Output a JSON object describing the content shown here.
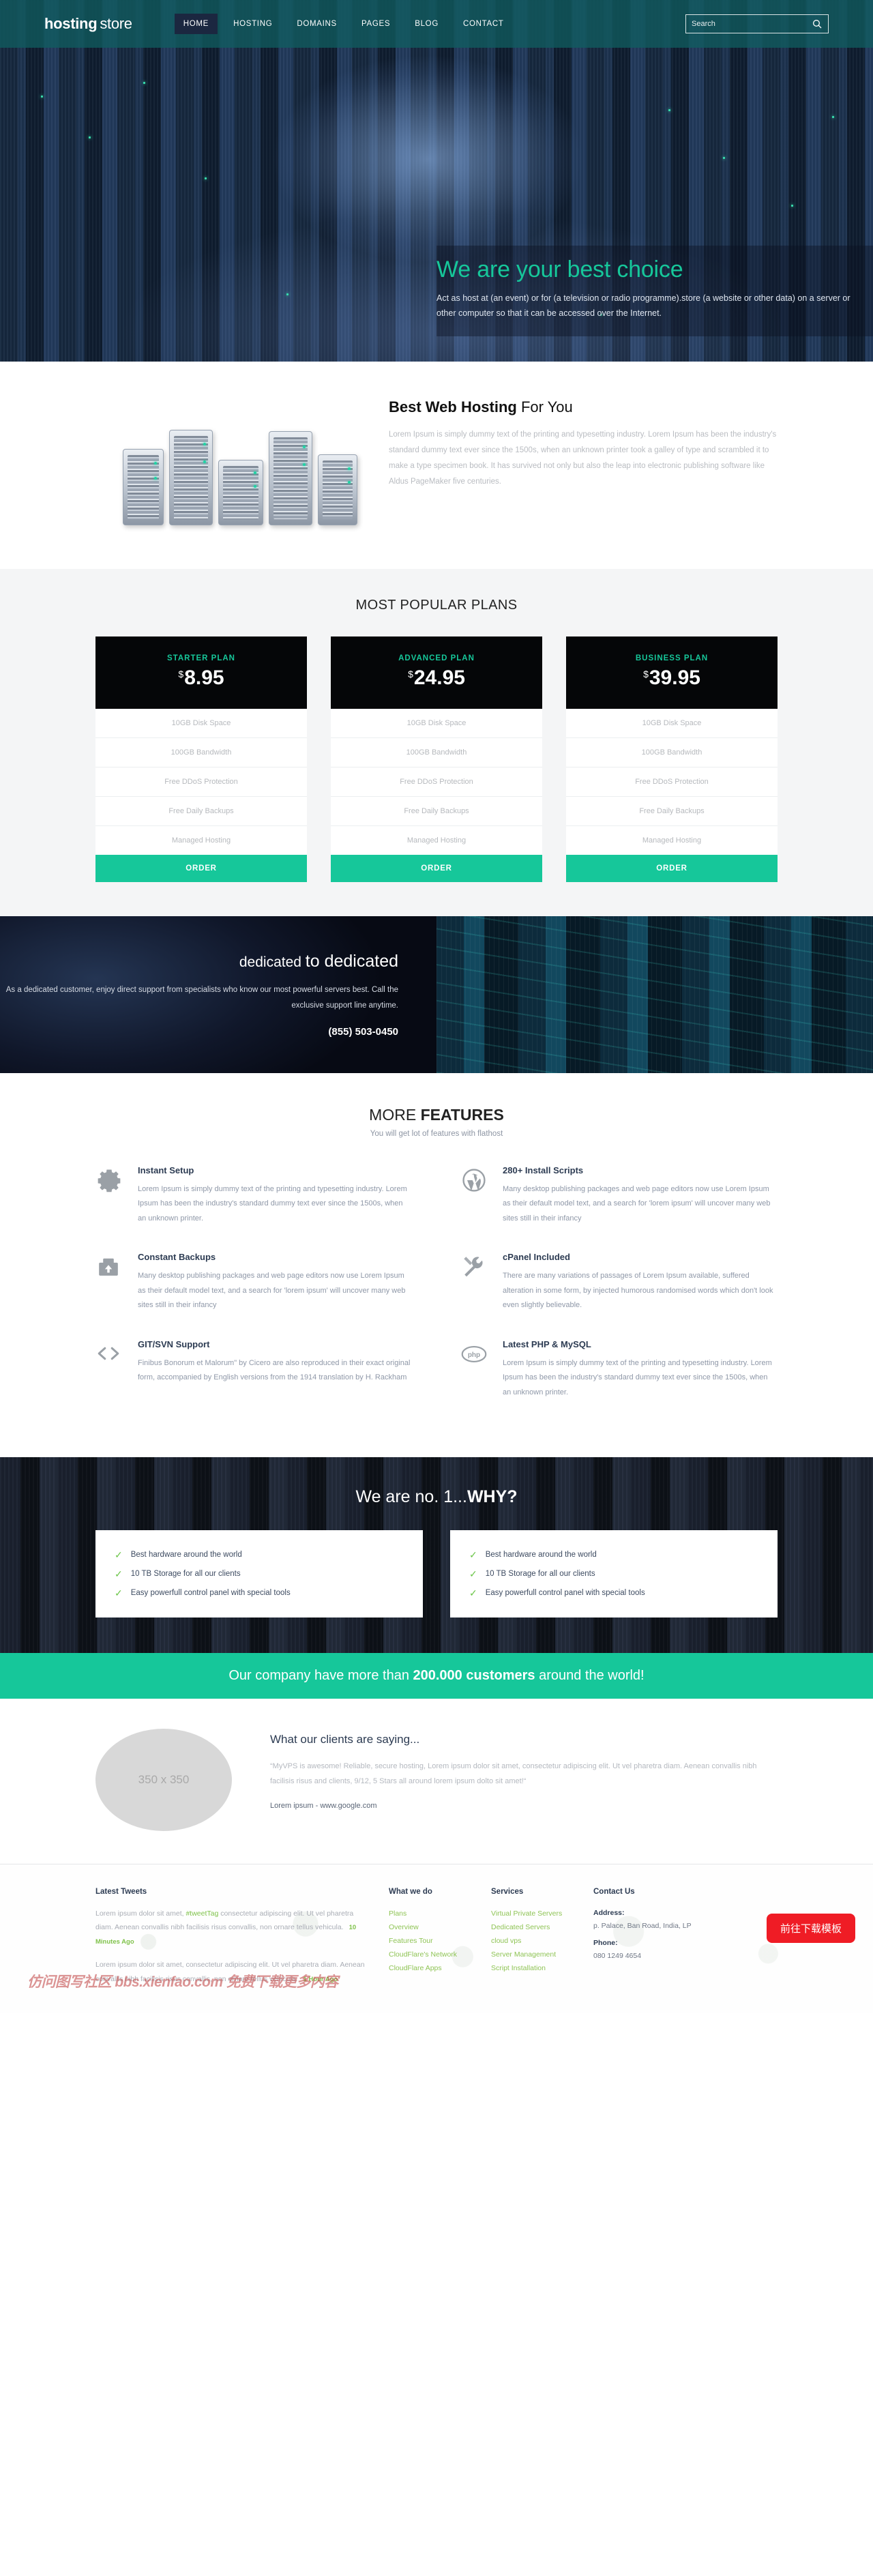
{
  "brand": {
    "name_bold": "hosting",
    "name_light": "store"
  },
  "nav": {
    "items": [
      {
        "label": "HOME",
        "active": true
      },
      {
        "label": "HOSTING",
        "active": false
      },
      {
        "label": "DOMAINS",
        "active": false
      },
      {
        "label": "PAGES",
        "active": false
      },
      {
        "label": "BLOG",
        "active": false
      },
      {
        "label": "CONTACT",
        "active": false
      }
    ],
    "search_placeholder": "Search",
    "search_value": "",
    "search_icon": "search-icon"
  },
  "hero": {
    "heading": "We are your best choice",
    "paragraph": "Act as host at (an event) or for (a television or radio programme).store (a website or other data) on a server or other computer so that it can be accessed over the Internet."
  },
  "best": {
    "title_bold": "Best Web Hosting",
    "title_light": " For You",
    "paragraph": "Lorem Ipsum is simply dummy text of the printing and typesetting industry. Lorem Ipsum has been the industry's standard dummy text ever since the 1500s, when an unknown printer took a galley of type and scrambled it to make a type specimen book. It has survived not only but also the leap into electronic publishing software like Aldus PageMaker five centuries."
  },
  "plans": {
    "section_title": "MOST POPULAR PLANS",
    "order_label": "ORDER",
    "currency": "$",
    "items": [
      {
        "name": "STARTER PLAN",
        "price": "8.95",
        "features": [
          "10GB Disk Space",
          "100GB Bandwidth",
          "Free DDoS Protection",
          "Free Daily Backups",
          "Managed Hosting"
        ]
      },
      {
        "name": "ADVANCED PLAN",
        "price": "24.95",
        "features": [
          "10GB Disk Space",
          "100GB Bandwidth",
          "Free DDoS Protection",
          "Free Daily Backups",
          "Managed Hosting"
        ]
      },
      {
        "name": "BUSINESS PLAN",
        "price": "39.95",
        "features": [
          "10GB Disk Space",
          "100GB Bandwidth",
          "Free DDoS Protection",
          "Free Daily Backups",
          "Managed Hosting"
        ]
      }
    ]
  },
  "dedicated": {
    "title_light": "dedicated ",
    "title_bold": "to dedicated",
    "paragraph": "As a dedicated customer, enjoy direct support from specialists who know our most powerful servers best. Call the exclusive support line anytime.",
    "phone": "(855) 503-0450"
  },
  "features": {
    "title_light": "MORE ",
    "title_bold": "FEATURES",
    "subtitle": "You will get lot of features with flathost",
    "items": [
      {
        "icon": "gear-icon",
        "title": "Instant Setup",
        "text": "Lorem Ipsum is simply dummy text of the printing and typesetting industry. Lorem Ipsum has been the industry's standard dummy text ever since the 1500s, when an unknown printer."
      },
      {
        "icon": "wordpress-icon",
        "title": "280+ Install Scripts",
        "text": "Many desktop publishing packages and web page editors now use Lorem Ipsum as their default model text, and a search for 'lorem ipsum' will uncover many web sites still in their infancy"
      },
      {
        "icon": "backup-icon",
        "title": "Constant Backups",
        "text": "Many desktop publishing packages and web page editors now use Lorem Ipsum as their default model text, and a search for 'lorem ipsum' will uncover many web sites still in their infancy"
      },
      {
        "icon": "wrench-icon",
        "title": "cPanel Included",
        "text": "There are many variations of passages of Lorem Ipsum available, suffered alteration in some form, by injected humorous randomised words which don't look even slightly believable."
      },
      {
        "icon": "code-icon",
        "title": "GIT/SVN Support",
        "text": "Finibus Bonorum et Malorum\" by Cicero are also reproduced in their exact original form, accompanied by English versions from the 1914 translation by H. Rackham"
      },
      {
        "icon": "php-icon",
        "title": "Latest PHP & MySQL",
        "text": "Lorem Ipsum is simply dummy text of the printing and typesetting industry. Lorem Ipsum has been the industry's standard dummy text ever since the 1500s, when an unknown printer."
      }
    ]
  },
  "why": {
    "title_light": "We are no. 1...",
    "title_bold": "WHY?",
    "left_list": [
      "Best hardware around the world",
      "10 TB Storage for all our clients",
      "Easy powerfull control panel with special tools"
    ],
    "right_list": [
      "Best hardware around the world",
      "10 TB Storage for all our clients",
      "Easy powerfull control panel with special tools"
    ],
    "tick_icon": "check-icon"
  },
  "banner": {
    "prefix": "Our company have more than ",
    "highlight": "200.000 customers",
    "suffix": " around the world!"
  },
  "testimonial": {
    "placeholder": "350 x 350",
    "title": "What our clients are saying...",
    "quote": "“MyVPS is awesome! Reliable, secure hosting, Lorem ipsum dolor sit amet, consectetur adipiscing elit. Ut vel pharetra diam. Aenean convallis nibh facilisis risus and clients, 9/12, 5 Stars all around lorem ipsum dolto sit amet!“",
    "author": "Lorem ipsum - www.google.com"
  },
  "footer": {
    "tweets_heading": "Latest Tweets",
    "tweets": [
      {
        "before": "Lorem ipsum dolor sit amet, ",
        "tag": "#tweetTag",
        "after": " consectetur adipiscing elit. Ut vel pharetra diam. Aenean convallis nibh facilisis risus convallis, non ornare tellus vehicula.",
        "ago": "10 Minutes Ago"
      },
      {
        "before": "Lorem ipsum dolor sit amet, consectetur adipiscing elit. Ut vel pharetra diam. Aenean convallis nibh facilisis risus convallis, non ornare tellus vehicula.",
        "tag": "",
        "after": "",
        "ago": "1 Hour Ago"
      }
    ],
    "what_we_do_heading": "What we do",
    "what_we_do_links": [
      "Plans",
      "Overview",
      "Features Tour",
      "CloudFlare's Network",
      "CloudFlare Apps"
    ],
    "services_heading": "Services",
    "services_links": [
      "Virtual Private Servers",
      "Dedicated Servers",
      "cloud vps",
      "Server Management",
      "Script Installation"
    ],
    "contact_heading": "Contact Us",
    "address_label": "Address:",
    "address_value": "p. Palace, Ban\nRoad, India, LP",
    "phone_label": "Phone:",
    "phone_value": "080 1249 4654",
    "download_badge": "前往下载模板",
    "watermark": "仿问图写社区 bbs.xienfao.com 免费下载更多内容"
  },
  "colors": {
    "accent": "#16c79a",
    "teal_header": "#0f5f61",
    "dark": "#050608",
    "green_link": "#8fc455"
  }
}
